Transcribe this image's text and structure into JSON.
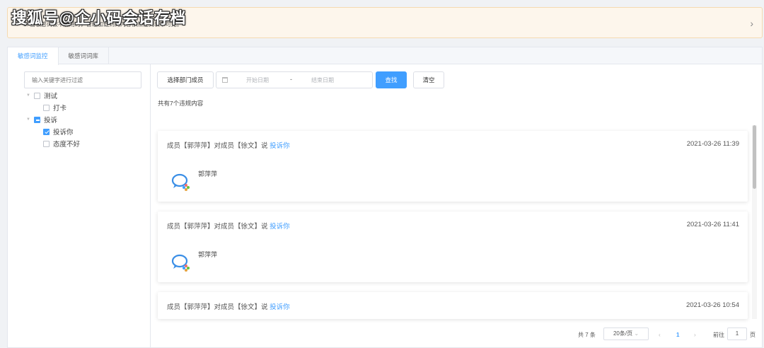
{
  "watermark": "搜狐号@企小码会话存档",
  "notice": {
    "text": "1. 当敏感词被不启用时，曾经加载到的内容依然在列表中可见。",
    "arrow": "›"
  },
  "tabs": [
    {
      "label": "敏感词监控",
      "active": true
    },
    {
      "label": "敏感词词库",
      "active": false
    }
  ],
  "tree": {
    "filter_placeholder": "输入关键字进行过滤",
    "nodes": [
      {
        "label": "测试",
        "state": "unchecked",
        "caret": true
      },
      {
        "label": "打卡",
        "state": "unchecked",
        "caret": false
      },
      {
        "label": "投诉",
        "state": "indeterminate",
        "caret": true
      },
      {
        "label": "投诉你",
        "state": "checked",
        "caret": false
      },
      {
        "label": "态度不好",
        "state": "unchecked",
        "caret": false
      }
    ]
  },
  "toolbar": {
    "dept_button": "选择部门成员",
    "start_placeholder": "开始日期",
    "separator": "-",
    "end_placeholder": "结束日期",
    "search_button": "查找",
    "clear_button": "清空"
  },
  "results_count": "共有7个违规内容",
  "cards": [
    {
      "text": "成员【郭萍萍】对成员【徐文】说",
      "keyword": "投诉你",
      "time": "2021-03-26 11:39",
      "sender": "郭萍萍"
    },
    {
      "text": "成员【郭萍萍】对成员【徐文】说",
      "keyword": "投诉你",
      "time": "2021-03-26 11:41",
      "sender": "郭萍萍"
    },
    {
      "text": "成员【郭萍萍】对成员【徐文】说",
      "keyword": "投诉你",
      "time": "2021-03-26 10:54",
      "sender": ""
    }
  ],
  "pagination": {
    "total": "共 7 条",
    "page_size": "20条/页",
    "prev": "‹",
    "current": "1",
    "next": "›",
    "goto_label": "前往",
    "goto_value": "1",
    "page_suffix": "页"
  },
  "colors": {
    "accent": "#409eff",
    "notice_bg": "#fdf6ec"
  }
}
